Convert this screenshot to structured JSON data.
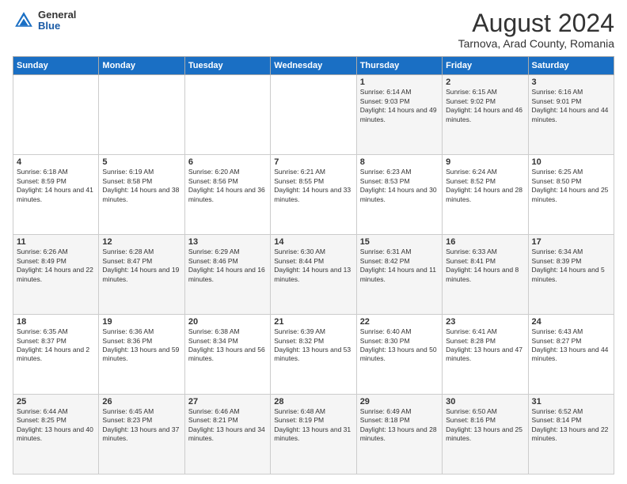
{
  "header": {
    "logo_general": "General",
    "logo_blue": "Blue",
    "main_title": "August 2024",
    "subtitle": "Tarnova, Arad County, Romania"
  },
  "days_header": [
    "Sunday",
    "Monday",
    "Tuesday",
    "Wednesday",
    "Thursday",
    "Friday",
    "Saturday"
  ],
  "weeks": [
    [
      {
        "day": "",
        "sunrise": "",
        "sunset": "",
        "daylight": ""
      },
      {
        "day": "",
        "sunrise": "",
        "sunset": "",
        "daylight": ""
      },
      {
        "day": "",
        "sunrise": "",
        "sunset": "",
        "daylight": ""
      },
      {
        "day": "",
        "sunrise": "",
        "sunset": "",
        "daylight": ""
      },
      {
        "day": "1",
        "sunrise": "Sunrise: 6:14 AM",
        "sunset": "Sunset: 9:03 PM",
        "daylight": "Daylight: 14 hours and 49 minutes."
      },
      {
        "day": "2",
        "sunrise": "Sunrise: 6:15 AM",
        "sunset": "Sunset: 9:02 PM",
        "daylight": "Daylight: 14 hours and 46 minutes."
      },
      {
        "day": "3",
        "sunrise": "Sunrise: 6:16 AM",
        "sunset": "Sunset: 9:01 PM",
        "daylight": "Daylight: 14 hours and 44 minutes."
      }
    ],
    [
      {
        "day": "4",
        "sunrise": "Sunrise: 6:18 AM",
        "sunset": "Sunset: 8:59 PM",
        "daylight": "Daylight: 14 hours and 41 minutes."
      },
      {
        "day": "5",
        "sunrise": "Sunrise: 6:19 AM",
        "sunset": "Sunset: 8:58 PM",
        "daylight": "Daylight: 14 hours and 38 minutes."
      },
      {
        "day": "6",
        "sunrise": "Sunrise: 6:20 AM",
        "sunset": "Sunset: 8:56 PM",
        "daylight": "Daylight: 14 hours and 36 minutes."
      },
      {
        "day": "7",
        "sunrise": "Sunrise: 6:21 AM",
        "sunset": "Sunset: 8:55 PM",
        "daylight": "Daylight: 14 hours and 33 minutes."
      },
      {
        "day": "8",
        "sunrise": "Sunrise: 6:23 AM",
        "sunset": "Sunset: 8:53 PM",
        "daylight": "Daylight: 14 hours and 30 minutes."
      },
      {
        "day": "9",
        "sunrise": "Sunrise: 6:24 AM",
        "sunset": "Sunset: 8:52 PM",
        "daylight": "Daylight: 14 hours and 28 minutes."
      },
      {
        "day": "10",
        "sunrise": "Sunrise: 6:25 AM",
        "sunset": "Sunset: 8:50 PM",
        "daylight": "Daylight: 14 hours and 25 minutes."
      }
    ],
    [
      {
        "day": "11",
        "sunrise": "Sunrise: 6:26 AM",
        "sunset": "Sunset: 8:49 PM",
        "daylight": "Daylight: 14 hours and 22 minutes."
      },
      {
        "day": "12",
        "sunrise": "Sunrise: 6:28 AM",
        "sunset": "Sunset: 8:47 PM",
        "daylight": "Daylight: 14 hours and 19 minutes."
      },
      {
        "day": "13",
        "sunrise": "Sunrise: 6:29 AM",
        "sunset": "Sunset: 8:46 PM",
        "daylight": "Daylight: 14 hours and 16 minutes."
      },
      {
        "day": "14",
        "sunrise": "Sunrise: 6:30 AM",
        "sunset": "Sunset: 8:44 PM",
        "daylight": "Daylight: 14 hours and 13 minutes."
      },
      {
        "day": "15",
        "sunrise": "Sunrise: 6:31 AM",
        "sunset": "Sunset: 8:42 PM",
        "daylight": "Daylight: 14 hours and 11 minutes."
      },
      {
        "day": "16",
        "sunrise": "Sunrise: 6:33 AM",
        "sunset": "Sunset: 8:41 PM",
        "daylight": "Daylight: 14 hours and 8 minutes."
      },
      {
        "day": "17",
        "sunrise": "Sunrise: 6:34 AM",
        "sunset": "Sunset: 8:39 PM",
        "daylight": "Daylight: 14 hours and 5 minutes."
      }
    ],
    [
      {
        "day": "18",
        "sunrise": "Sunrise: 6:35 AM",
        "sunset": "Sunset: 8:37 PM",
        "daylight": "Daylight: 14 hours and 2 minutes."
      },
      {
        "day": "19",
        "sunrise": "Sunrise: 6:36 AM",
        "sunset": "Sunset: 8:36 PM",
        "daylight": "Daylight: 13 hours and 59 minutes."
      },
      {
        "day": "20",
        "sunrise": "Sunrise: 6:38 AM",
        "sunset": "Sunset: 8:34 PM",
        "daylight": "Daylight: 13 hours and 56 minutes."
      },
      {
        "day": "21",
        "sunrise": "Sunrise: 6:39 AM",
        "sunset": "Sunset: 8:32 PM",
        "daylight": "Daylight: 13 hours and 53 minutes."
      },
      {
        "day": "22",
        "sunrise": "Sunrise: 6:40 AM",
        "sunset": "Sunset: 8:30 PM",
        "daylight": "Daylight: 13 hours and 50 minutes."
      },
      {
        "day": "23",
        "sunrise": "Sunrise: 6:41 AM",
        "sunset": "Sunset: 8:28 PM",
        "daylight": "Daylight: 13 hours and 47 minutes."
      },
      {
        "day": "24",
        "sunrise": "Sunrise: 6:43 AM",
        "sunset": "Sunset: 8:27 PM",
        "daylight": "Daylight: 13 hours and 44 minutes."
      }
    ],
    [
      {
        "day": "25",
        "sunrise": "Sunrise: 6:44 AM",
        "sunset": "Sunset: 8:25 PM",
        "daylight": "Daylight: 13 hours and 40 minutes."
      },
      {
        "day": "26",
        "sunrise": "Sunrise: 6:45 AM",
        "sunset": "Sunset: 8:23 PM",
        "daylight": "Daylight: 13 hours and 37 minutes."
      },
      {
        "day": "27",
        "sunrise": "Sunrise: 6:46 AM",
        "sunset": "Sunset: 8:21 PM",
        "daylight": "Daylight: 13 hours and 34 minutes."
      },
      {
        "day": "28",
        "sunrise": "Sunrise: 6:48 AM",
        "sunset": "Sunset: 8:19 PM",
        "daylight": "Daylight: 13 hours and 31 minutes."
      },
      {
        "day": "29",
        "sunrise": "Sunrise: 6:49 AM",
        "sunset": "Sunset: 8:18 PM",
        "daylight": "Daylight: 13 hours and 28 minutes."
      },
      {
        "day": "30",
        "sunrise": "Sunrise: 6:50 AM",
        "sunset": "Sunset: 8:16 PM",
        "daylight": "Daylight: 13 hours and 25 minutes."
      },
      {
        "day": "31",
        "sunrise": "Sunrise: 6:52 AM",
        "sunset": "Sunset: 8:14 PM",
        "daylight": "Daylight: 13 hours and 22 minutes."
      }
    ]
  ]
}
